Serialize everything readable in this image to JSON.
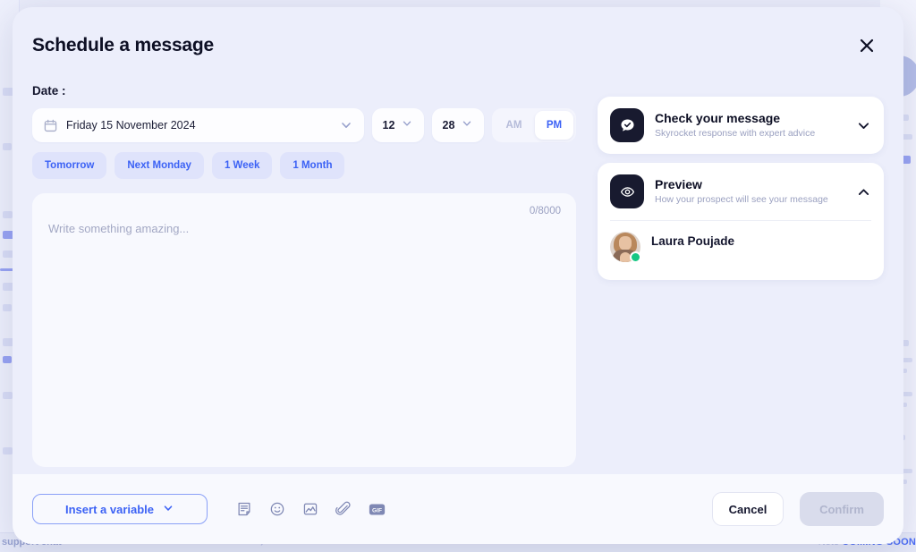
{
  "background": {
    "bottom_bar": {
      "left_label": "support chat",
      "note_label": "Note",
      "coming_soon_label": "COMING SOON",
      "icon": "external-link-icon"
    }
  },
  "modal": {
    "title": "Schedule a message",
    "close_icon": "close-icon",
    "date_section": {
      "label": "Date :",
      "calendar_icon": "calendar-icon",
      "date_value": "Friday 15 November 2024",
      "date_chevron_icon": "chevron-down-icon",
      "hour_value": "12",
      "hour_chevron_icon": "chevron-down-icon",
      "minute_value": "28",
      "minute_chevron_icon": "chevron-down-icon",
      "meridiem": {
        "am_label": "AM",
        "pm_label": "PM",
        "selected": "PM"
      },
      "quick_chips": [
        {
          "label": "Tomorrow"
        },
        {
          "label": "Next Monday"
        },
        {
          "label": "1 Week"
        },
        {
          "label": "1 Month"
        }
      ]
    },
    "composer": {
      "placeholder": "Write something amazing...",
      "char_counter": "0/8000",
      "value": ""
    },
    "side_panels": [
      {
        "title": "Check your message",
        "subtitle": "Skyrocket response with expert advice",
        "icon": "chat-bubble-check-icon",
        "chevron_icon": "chevron-down-icon",
        "expanded": false
      },
      {
        "title": "Preview",
        "subtitle": "How your prospect will see your message",
        "icon": "eye-icon",
        "chevron_icon": "chevron-up-icon",
        "expanded": true
      }
    ],
    "preview": {
      "prospect_name": "Laura Poujade",
      "avatar": "profile-photo-avatar",
      "status": "online"
    },
    "footer": {
      "insert_variable_label": "Insert a variable",
      "insert_variable_chevron_icon": "chevron-down-icon",
      "tools": [
        {
          "icon": "note-template-icon"
        },
        {
          "icon": "emoji-smiley-icon"
        },
        {
          "icon": "image-icon"
        },
        {
          "icon": "attachment-paperclip-icon"
        },
        {
          "icon": "gif-icon"
        }
      ],
      "cancel_label": "Cancel",
      "confirm_label": "Confirm",
      "confirm_disabled": true
    }
  },
  "colors": {
    "accent_blue": "#3c62f5",
    "modal_bg": "#eceefb",
    "panel_bg": "#ffffff",
    "icon_dark": "#181a2f",
    "online_green": "#16c784",
    "chip_bg": "#dfe3fb"
  }
}
